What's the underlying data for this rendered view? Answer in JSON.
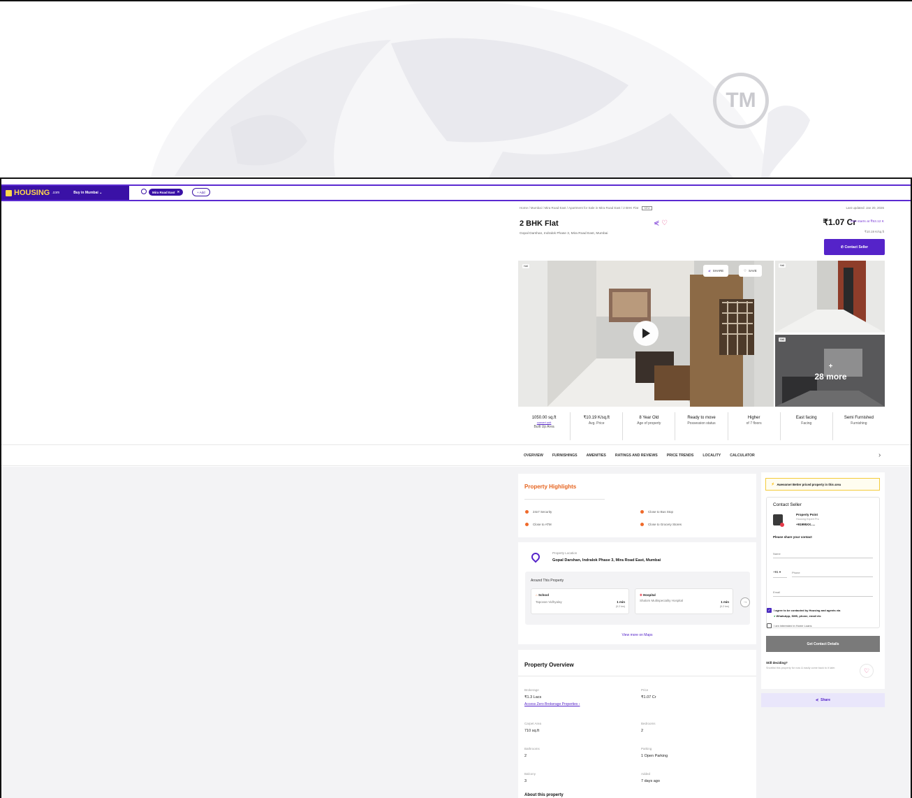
{
  "watermark": {
    "tm_label": "TM"
  },
  "navbar": {
    "logo_text": "HOUSING",
    "logo_suffix": ".com",
    "buy_in": "Buy in Mumbai",
    "search_chip": "Mira Road East",
    "add_chip": "+ Add"
  },
  "listing": {
    "breadcrumb": "Home / Mumbai / Mira Road East / Apartment for Sale in Mira Road East / 2 BHK Flat",
    "breadcrumb_badge": "NEW",
    "last_updated": "Last updated: Jan 20, 2026",
    "title": "2 BHK Flat",
    "address": "Gopal Darshan, Indralok Phase 3, Mira Road East, Mumbai",
    "price": "₹1.07 Cr",
    "emi": "EMI starts at ₹53.12 K",
    "rate": "₹10.19 K/sq.ft",
    "contact_btn": "Contact Seller"
  },
  "gallery": {
    "main_label": "Hall",
    "side1_label": "Hall",
    "side2_label": "Hall",
    "share_btn": "SHARE",
    "save_btn": "SAVE",
    "more_label": "+\n28 more"
  },
  "stats": [
    {
      "value": "1050.00 sq.ft",
      "link": "convert unit",
      "sub": "Built Up Area"
    },
    {
      "value": "₹10.19 K/sq.ft",
      "sub": "Avg. Price"
    },
    {
      "value": "8 Year Old",
      "sub": "Age of property"
    },
    {
      "value": "Ready to move",
      "sub": "Possession status"
    },
    {
      "value": "Higher",
      "sub": "of 7 floors"
    },
    {
      "value": "East facing",
      "sub": "Facing"
    },
    {
      "value": "Semi Furnished",
      "sub": "Furnishing"
    }
  ],
  "tabs": [
    "OVERVIEW",
    "FURNISHINGS",
    "AMENITIES",
    "RATINGS AND REVIEWS",
    "PRICE TRENDS",
    "LOCALITY",
    "CALCULATOR"
  ],
  "highlights": {
    "title": "Property Highlights",
    "items": [
      "24x7 Security",
      "Close to Bus Stop",
      "Close to ATM",
      "Close to Grocery Stores"
    ]
  },
  "location": {
    "label": "Property Location",
    "address": "Gopal Darshan, Indralok Phase 3, Mira Road East, Mumbai",
    "around_title": "Around This Property",
    "places": [
      {
        "type": "School",
        "name": "Tapovan Vidhyalay",
        "time": "1 min",
        "dist": "(0.2 km)"
      },
      {
        "type": "Hospital",
        "name": "Shalom Multispeciality Hospital",
        "time": "1 min",
        "dist": "(0.2 km)"
      }
    ],
    "view_maps": "View more on Maps"
  },
  "overview": {
    "title": "Property Overview",
    "brokerage_label": "Brokerage",
    "brokerage_val": "₹1.3 Lacs",
    "zero_brokerage_link": "Access Zero Brokerage Properties ›",
    "price_label": "Price",
    "price_val": "₹1.07 Cr",
    "carpet_label": "Carpet Area",
    "carpet_val": "710 sq.ft",
    "bedrooms_label": "Bedrooms",
    "bedrooms_val": "2",
    "bathrooms_label": "Bathrooms",
    "bathrooms_val": "2",
    "parking_label": "Parking",
    "parking_val": "1 Open Parking",
    "balcony_label": "Balcony",
    "balcony_val": "3",
    "added_label": "Added",
    "added_val": "7 days ago",
    "about_title": "About this property"
  },
  "sidebar": {
    "alert": "Awesome! Better priced property in this area",
    "contact_title": "Contact Seller",
    "seller_name": "Property Point",
    "seller_role": "Housing Expert Pro",
    "seller_phone": "+91995XX.....",
    "share_contact": "Please share your contact",
    "name_placeholder": "Name",
    "country_code": "+91",
    "phone_placeholder": "Phone",
    "email_placeholder": "Email",
    "consent": "I agree to be contacted by Housing and agents via",
    "consent2": "WhatsApp, SMS, phone, email etc",
    "home_loans": "I am interested in Home Loans",
    "get_details": "Get Contact Details",
    "still_deciding": "Still deciding?",
    "shortlist_text": "Shortlist this property for now & easily come back to it later.",
    "share_bar": "Share"
  },
  "colors": {
    "brand": "#5523c9",
    "accent_orange": "#e6641f"
  }
}
